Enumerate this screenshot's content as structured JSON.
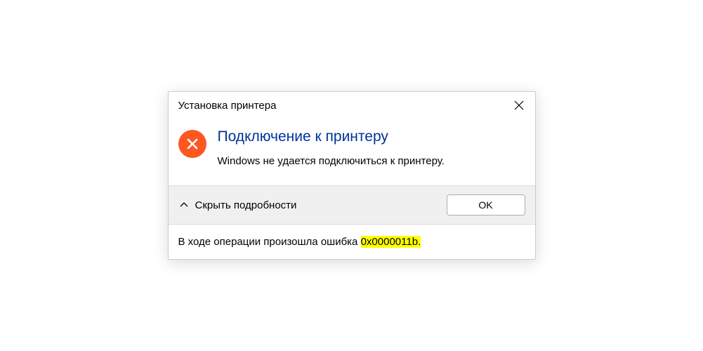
{
  "titlebar": {
    "title": "Установка принтера"
  },
  "content": {
    "heading": "Подключение к принтеру",
    "message": "Windows не удается подключиться к принтеру."
  },
  "footer": {
    "details_label": "Скрыть подробности",
    "ok_label": "OK"
  },
  "details": {
    "prefix": "В ходе операции произошла ошибка ",
    "code": "0x0000011b",
    "suffix": "."
  }
}
